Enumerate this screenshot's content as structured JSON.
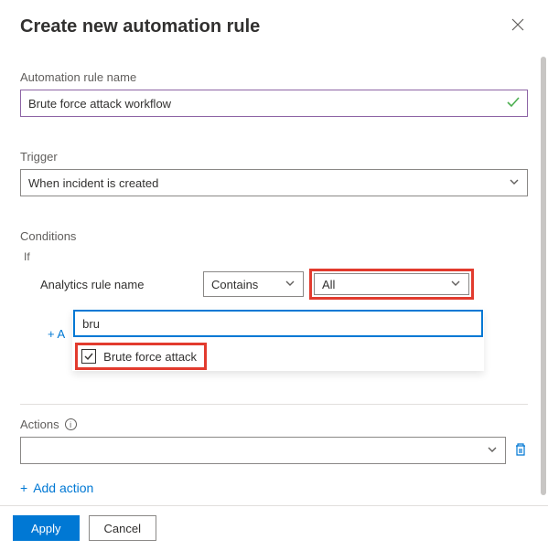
{
  "title": "Create new automation rule",
  "rule_name": {
    "label": "Automation rule name",
    "value": "Brute force attack workflow"
  },
  "trigger": {
    "label": "Trigger",
    "value": "When incident is created"
  },
  "conditions": {
    "label": "Conditions",
    "if": "If",
    "field_label": "Analytics rule name",
    "operator": "Contains",
    "scope": "All",
    "filter_value": "bru",
    "option": "Brute force attack",
    "add_small": "+ A"
  },
  "actions": {
    "label": "Actions",
    "add": "Add action"
  },
  "footer": {
    "apply": "Apply",
    "cancel": "Cancel"
  }
}
